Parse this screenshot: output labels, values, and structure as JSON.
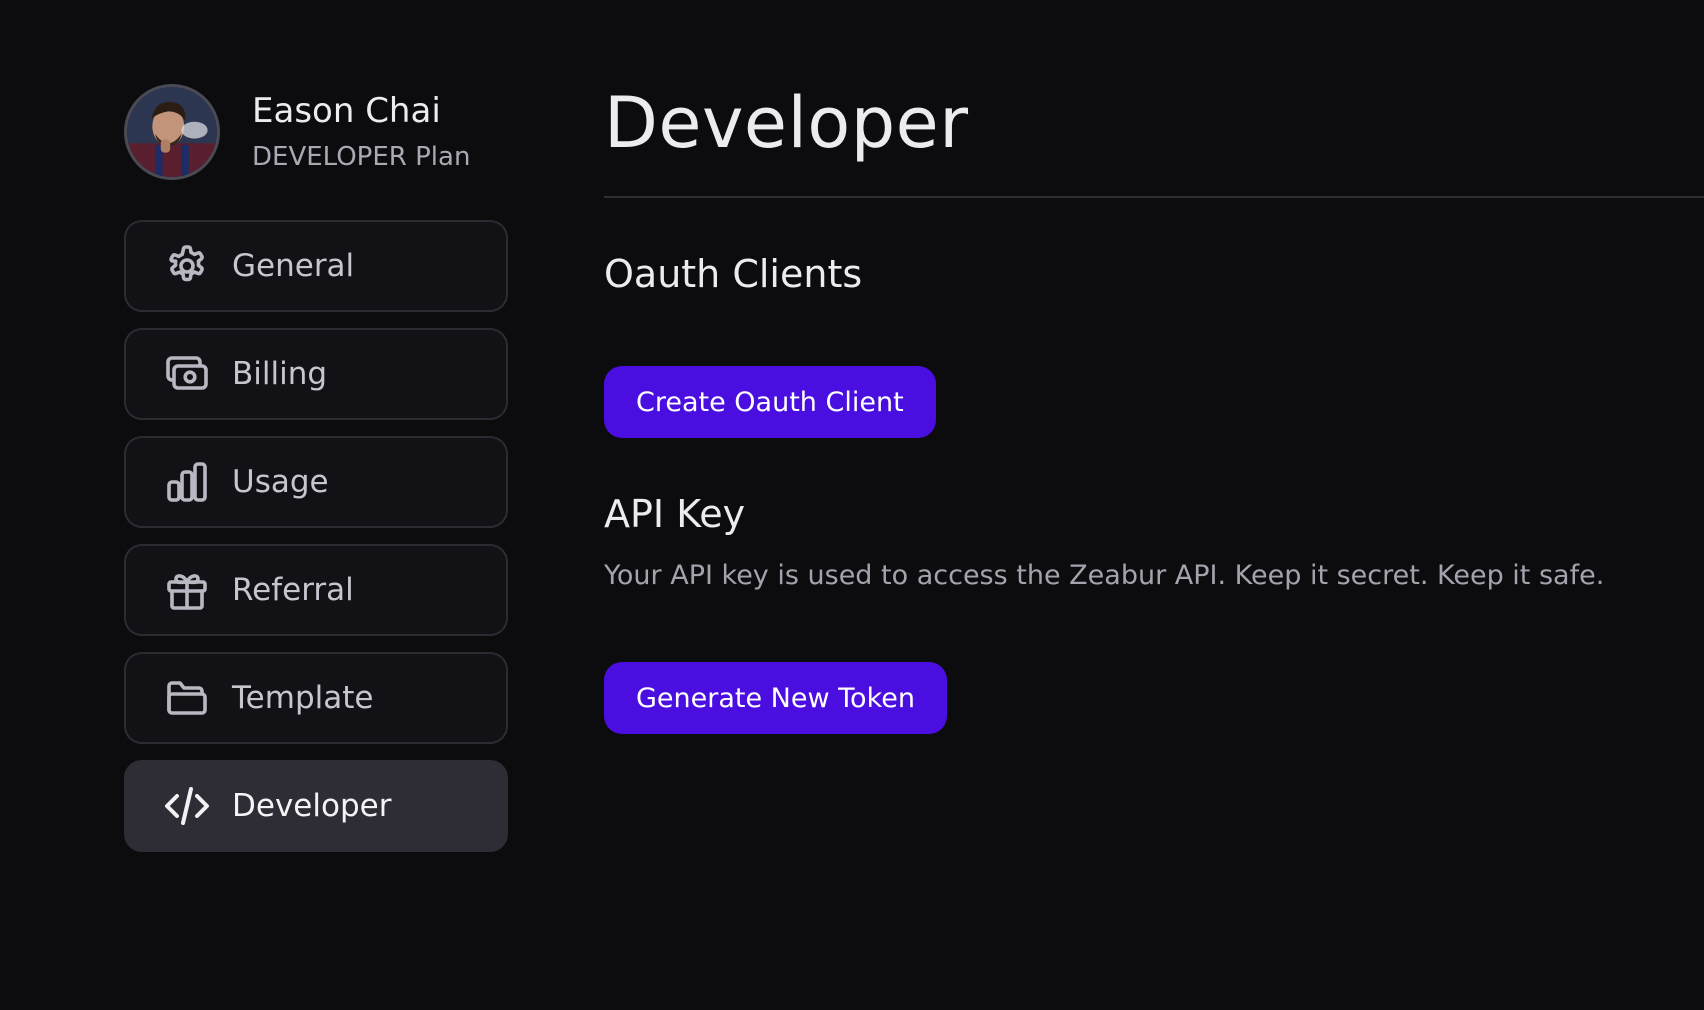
{
  "profile": {
    "name": "Eason Chai",
    "plan": "DEVELOPER Plan"
  },
  "sidebar": {
    "items": [
      {
        "label": "General",
        "icon": "gear-icon"
      },
      {
        "label": "Billing",
        "icon": "billing-icon"
      },
      {
        "label": "Usage",
        "icon": "bar-chart-icon"
      },
      {
        "label": "Referral",
        "icon": "gift-icon"
      },
      {
        "label": "Template",
        "icon": "folder-icon"
      },
      {
        "label": "Developer",
        "icon": "code-icon",
        "active": true
      }
    ]
  },
  "main": {
    "title": "Developer",
    "oauth": {
      "heading": "Oauth Clients",
      "button_label": "Create Oauth Client"
    },
    "api_key": {
      "heading": "API Key",
      "description": "Your API key is used to access the Zeabur API. Keep it secret. Keep it safe.",
      "button_label": "Generate New Token"
    }
  },
  "colors": {
    "background": "#0c0c0f",
    "primary_button": "#4a0fe0",
    "active_nav": "#2e2d36"
  }
}
